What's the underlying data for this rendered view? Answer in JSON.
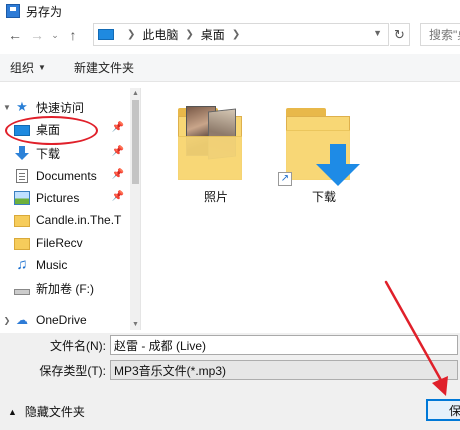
{
  "window": {
    "title": "另存为"
  },
  "nav": {
    "back": "←",
    "forward": "→",
    "recent": "⌄",
    "up": "↑",
    "breadcrumb": [
      "此电脑",
      "桌面"
    ],
    "refresh": "↻",
    "search_placeholder": "搜索\"桌"
  },
  "toolbar": {
    "organize": "组织",
    "new_folder": "新建文件夹"
  },
  "sidebar": {
    "items": [
      {
        "label": "快速访问",
        "icon": "star-icon"
      },
      {
        "label": "桌面",
        "icon": "desktop-icon",
        "pinned": true
      },
      {
        "label": "下载",
        "icon": "download-icon",
        "pinned": true
      },
      {
        "label": "Documents",
        "icon": "document-icon",
        "pinned": true
      },
      {
        "label": "Pictures",
        "icon": "pictures-icon",
        "pinned": true
      },
      {
        "label": "Candle.in.The.T",
        "icon": "folder-icon"
      },
      {
        "label": "FileRecv",
        "icon": "folder-icon"
      },
      {
        "label": "Music",
        "icon": "music-icon"
      },
      {
        "label": "新加卷 (F:)",
        "icon": "drive-icon"
      },
      {
        "label": "OneDrive",
        "icon": "cloud-icon"
      }
    ]
  },
  "content": {
    "files": [
      {
        "label": "照片",
        "icon": "photo-folder-icon"
      },
      {
        "label": "下载",
        "icon": "download-folder-icon"
      }
    ]
  },
  "fields": {
    "filename_label": "文件名(N):",
    "filename_value": "赵雷 - 成都 (Live)",
    "filetype_label": "保存类型(T):",
    "filetype_value": "MP3音乐文件(*.mp3)"
  },
  "footer": {
    "hide_folders": "隐藏文件夹",
    "save_label": "保"
  },
  "colors": {
    "accent": "#0078d7",
    "annotation": "#e0202a",
    "folder": "#f8d775"
  }
}
